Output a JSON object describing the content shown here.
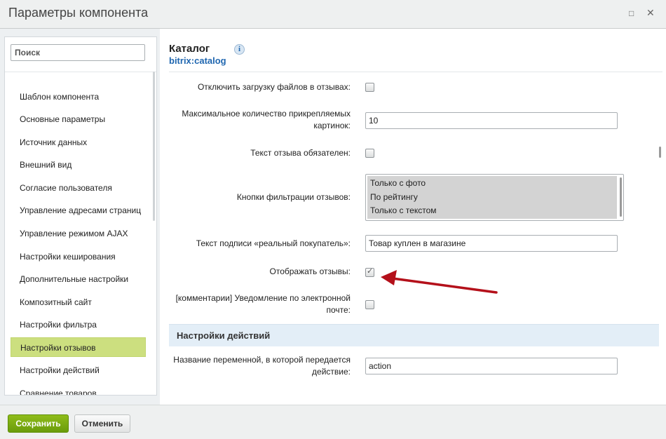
{
  "window": {
    "title": "Параметры компонента",
    "maximize_icon": "□",
    "close_icon": "✕"
  },
  "sidebar": {
    "search_placeholder": "Поиск",
    "items": [
      {
        "label": "Шаблон компонента"
      },
      {
        "label": "Основные параметры"
      },
      {
        "label": "Источник данных"
      },
      {
        "label": "Внешний вид"
      },
      {
        "label": "Согласие пользователя"
      },
      {
        "label": "Управление адресами страниц"
      },
      {
        "label": "Управление режимом AJAX"
      },
      {
        "label": "Настройки кеширования"
      },
      {
        "label": "Дополнительные настройки"
      },
      {
        "label": "Композитный сайт"
      },
      {
        "label": "Настройки фильтра"
      },
      {
        "label": "Настройки отзывов",
        "active": true
      },
      {
        "label": "Настройки действий"
      },
      {
        "label": "Сравнение товаров"
      }
    ]
  },
  "component": {
    "title": "Каталог",
    "code": "bitrix:catalog",
    "info_icon": "i"
  },
  "params": {
    "disable_file_upload": {
      "label": "Отключить загрузку файлов в отзывах:",
      "checked": false
    },
    "max_images": {
      "label_line1": "Максимальное количество прикрепляемых",
      "label_line2": "картинок:",
      "value": "10"
    },
    "review_text_required": {
      "label": "Текст отзыва обязателен:",
      "checked": false
    },
    "filter_buttons": {
      "label": "Кнопки фильтрации отзывов:",
      "options": [
        "Только с фото",
        "По рейтингу",
        "Только с текстом"
      ]
    },
    "buyer_caption": {
      "label": "Текст подписи «реальный покупатель»:",
      "value": "Товар куплен в магазине"
    },
    "show_reviews": {
      "label": "Отображать отзывы:",
      "checked": true,
      "check_glyph": "✓"
    },
    "email_notify": {
      "label_line1": "[комментарии] Уведомление по электронной",
      "label_line2": "почте:",
      "checked": false
    }
  },
  "actions_section": {
    "title": "Настройки действий",
    "action_var": {
      "label_line1": "Название переменной, в которой передается",
      "label_line2": "действие:",
      "value": "action"
    }
  },
  "footer": {
    "save_label": "Сохранить",
    "cancel_label": "Отменить"
  },
  "colors": {
    "accent_green": "#7aaa12",
    "active_nav": "#ccdf7f",
    "link_blue": "#2067b0",
    "annotation_arrow": "#b4101a"
  }
}
